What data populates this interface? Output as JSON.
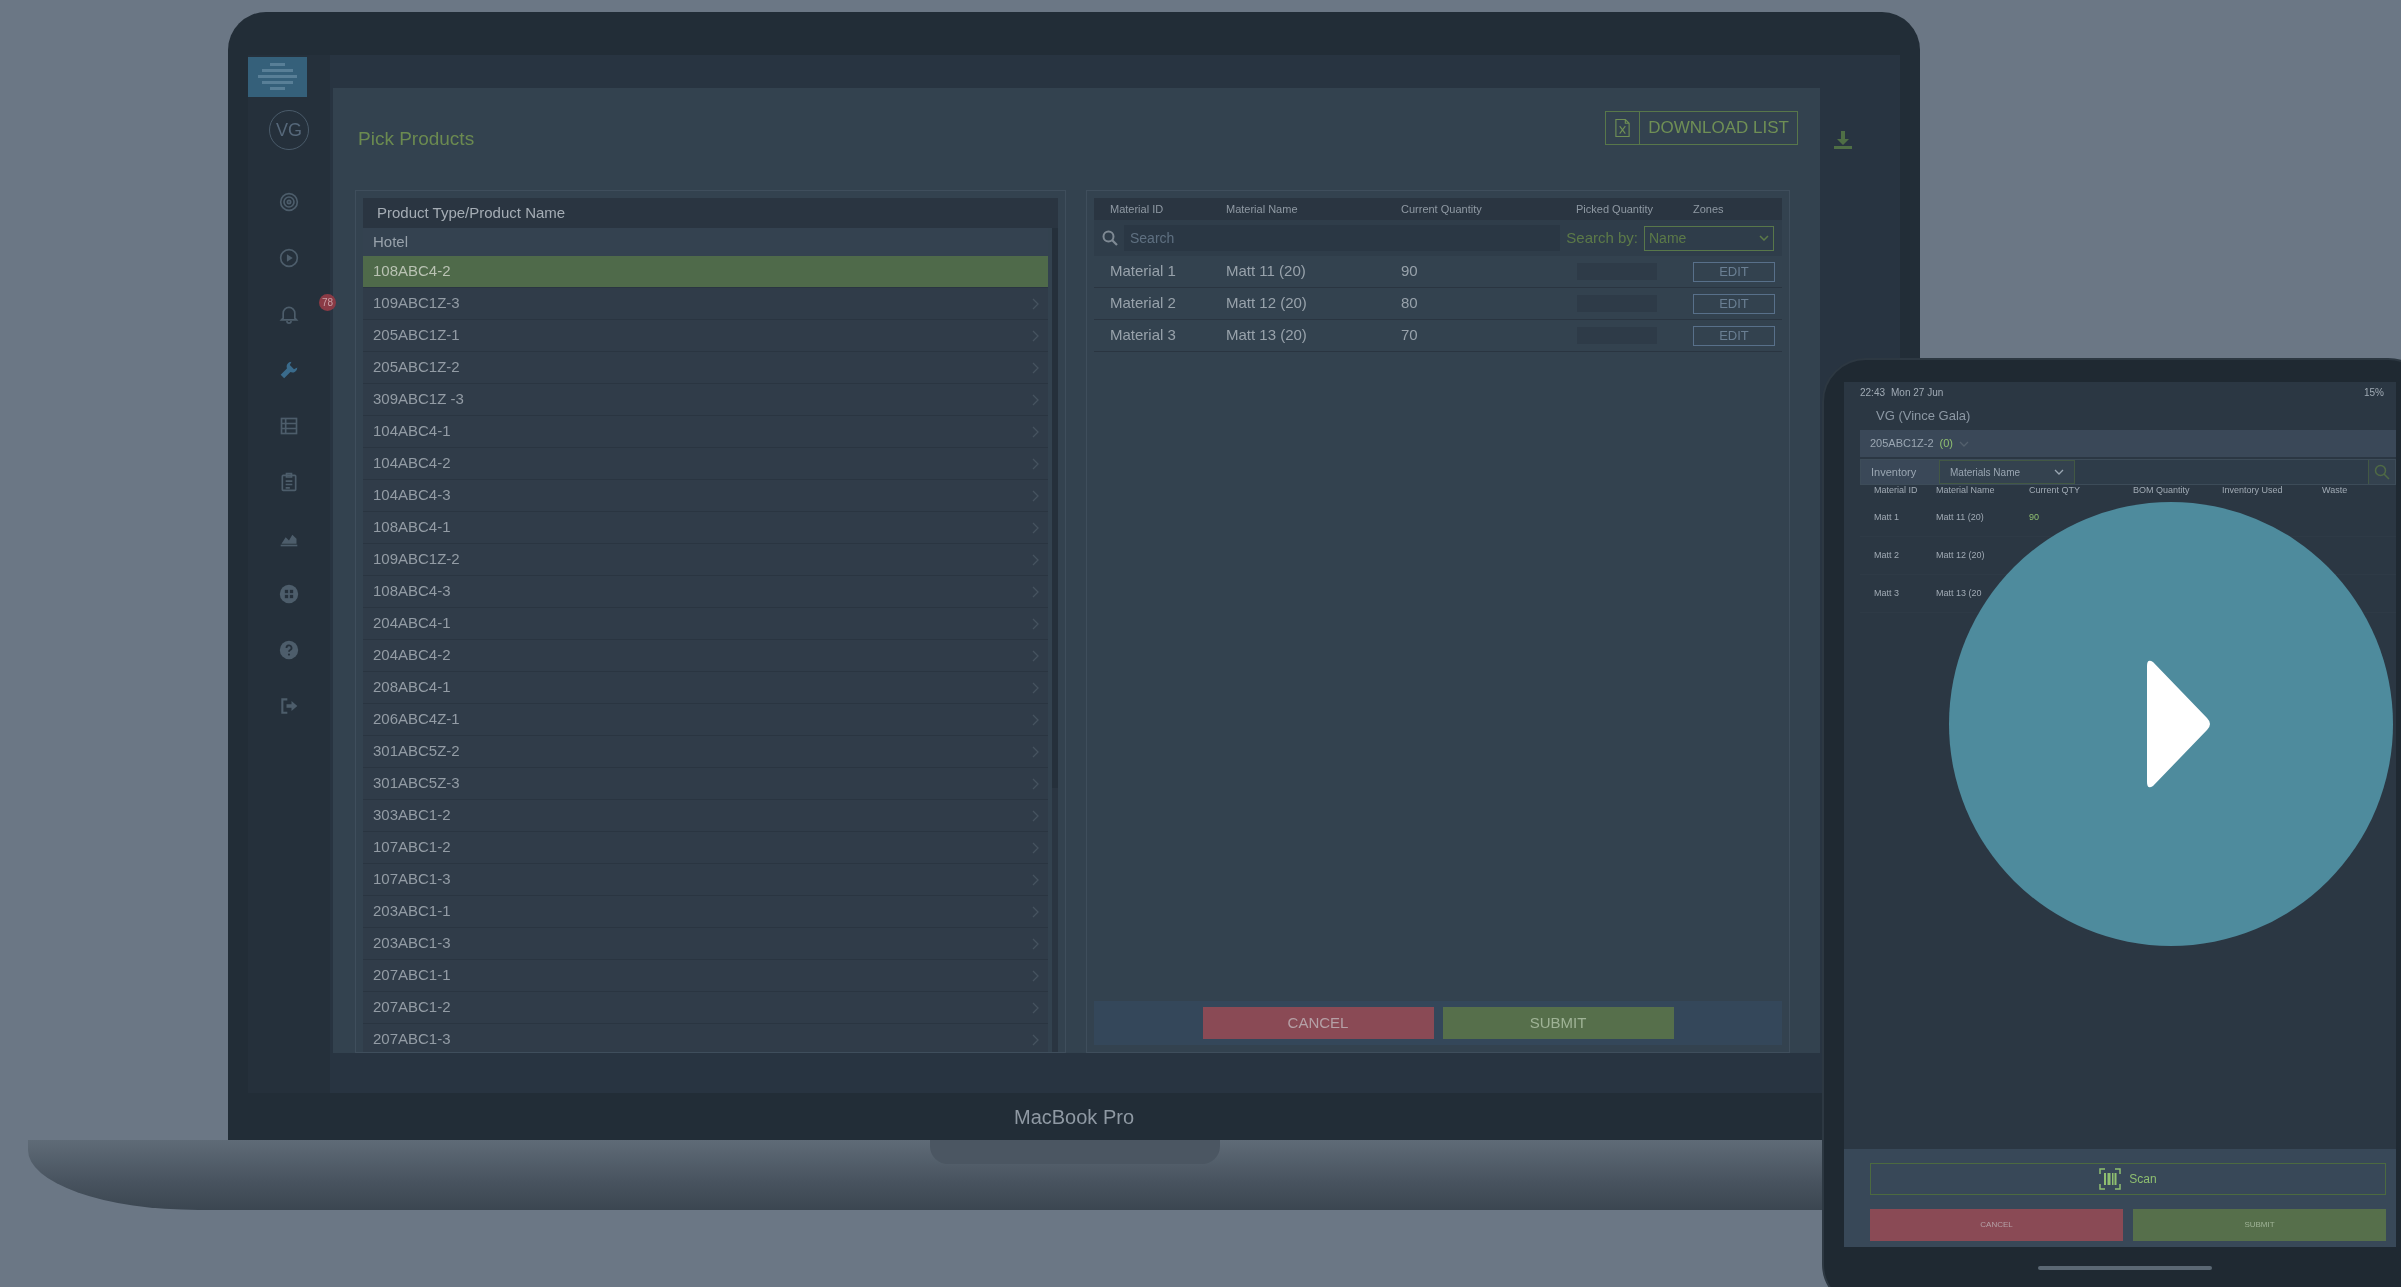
{
  "laptop": {
    "label": "MacBook Pro",
    "sidebar": {
      "avatar": "VG",
      "items": [
        {
          "kind": "target",
          "selected": false
        },
        {
          "kind": "play",
          "selected": false
        },
        {
          "kind": "bell",
          "selected": false,
          "badge": "78"
        },
        {
          "kind": "wrench",
          "selected": true
        },
        {
          "kind": "list",
          "selected": false
        },
        {
          "kind": "clipboard",
          "selected": false
        },
        {
          "kind": "chart",
          "selected": false
        },
        {
          "kind": "grid",
          "selected": false
        },
        {
          "kind": "help",
          "selected": false
        },
        {
          "kind": "logout",
          "selected": false
        }
      ]
    },
    "page": {
      "title": "Pick Products",
      "download_button": "DOWNLOAD LIST",
      "product_list": {
        "header": "Product Type/Product Name",
        "group": "Hotel",
        "items": [
          {
            "label": "108ABC4-2",
            "selected": true
          },
          {
            "label": "109ABC1Z-3",
            "selected": false
          },
          {
            "label": "205ABC1Z-1",
            "selected": false
          },
          {
            "label": "205ABC1Z-2",
            "selected": false
          },
          {
            "label": "309ABC1Z -3",
            "selected": false
          },
          {
            "label": "104ABC4-1",
            "selected": false
          },
          {
            "label": "104ABC4-2",
            "selected": false
          },
          {
            "label": "104ABC4-3",
            "selected": false
          },
          {
            "label": "108ABC4-1",
            "selected": false
          },
          {
            "label": "109ABC1Z-2",
            "selected": false
          },
          {
            "label": "108ABC4-3",
            "selected": false
          },
          {
            "label": "204ABC4-1",
            "selected": false
          },
          {
            "label": "204ABC4-2",
            "selected": false
          },
          {
            "label": "208ABC4-1",
            "selected": false
          },
          {
            "label": "206ABC4Z-1",
            "selected": false
          },
          {
            "label": "301ABC5Z-2",
            "selected": false
          },
          {
            "label": "301ABC5Z-3",
            "selected": false
          },
          {
            "label": "303ABC1-2",
            "selected": false
          },
          {
            "label": "107ABC1-2",
            "selected": false
          },
          {
            "label": "107ABC1-3",
            "selected": false
          },
          {
            "label": "203ABC1-1",
            "selected": false
          },
          {
            "label": "203ABC1-3",
            "selected": false
          },
          {
            "label": "207ABC1-1",
            "selected": false
          },
          {
            "label": "207ABC1-2",
            "selected": false
          },
          {
            "label": "207ABC1-3",
            "selected": false
          }
        ]
      },
      "materials": {
        "columns": [
          "Material ID",
          "Material Name",
          "Current Quantity",
          "Picked Quantity",
          "Zones"
        ],
        "search": {
          "placeholder": "Search",
          "search_by_label": "Search by:",
          "search_by_value": "Name"
        },
        "rows": [
          {
            "material_id": "Material 1",
            "material_name": "Matt 11 (20)",
            "current_quantity": "90",
            "action": "EDIT"
          },
          {
            "material_id": "Material 2",
            "material_name": "Matt 12 (20)",
            "current_quantity": "80",
            "action": "EDIT"
          },
          {
            "material_id": "Material 3",
            "material_name": "Matt 13 (20)",
            "current_quantity": "70",
            "action": "EDIT"
          }
        ]
      },
      "buttons": [
        {
          "label": "CANCEL",
          "kind": "cancel"
        },
        {
          "label": "SUBMIT",
          "kind": "submit"
        }
      ]
    }
  },
  "tablet": {
    "status": {
      "time": "22:43",
      "date": "Mon 27 Jun",
      "battery": "15%"
    },
    "title": "VG (Vince Gala)",
    "product": "205ABC1Z-2",
    "product_count": "(0)",
    "filter_label": "Inventory",
    "filter_value": "Materials Name",
    "columns": [
      "Material ID",
      "Material Name",
      "Current QTY",
      "BOM Quantity",
      "Inventory Used",
      "Waste"
    ],
    "rows": [
      {
        "material_id": "Matt 1",
        "material_name": "Matt 11 (20)",
        "current_qty": "90"
      },
      {
        "material_id": "Matt 2",
        "material_name": "Matt 12 (20)"
      },
      {
        "material_id": "Matt 3",
        "material_name": "Matt 13 (20"
      }
    ],
    "scan_button": "Scan",
    "buttons": [
      {
        "label": "CANCEL",
        "kind": "cancel"
      },
      {
        "label": "SUBMIT",
        "kind": "submit"
      }
    ]
  }
}
